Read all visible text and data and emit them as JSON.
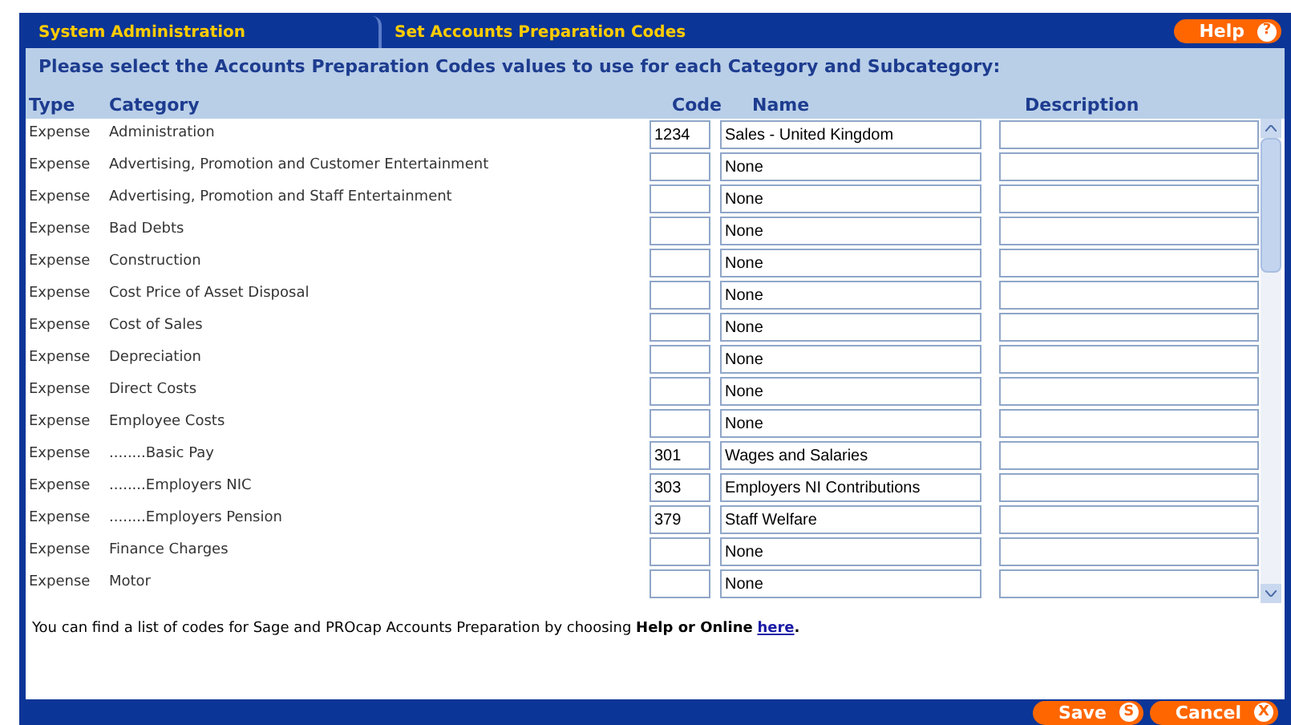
{
  "tabs": [
    {
      "label": "System Administration"
    },
    {
      "label": "Set Accounts Preparation Codes"
    }
  ],
  "help_button": {
    "label": "Help",
    "icon_text": "?"
  },
  "heading": "Please select the Accounts Preparation Codes values to use for each Category and Subcategory:",
  "columns": [
    "Type",
    "Category",
    "Code",
    "Name",
    "Description"
  ],
  "rows": [
    {
      "type": "Expense",
      "category": "Administration",
      "code": "1234",
      "name": "Sales - United Kingdom"
    },
    {
      "type": "Expense",
      "category": "Advertising, Promotion and Customer Entertainment",
      "code": "",
      "name": "None"
    },
    {
      "type": "Expense",
      "category": "Advertising, Promotion and Staff Entertainment",
      "code": "",
      "name": "None"
    },
    {
      "type": "Expense",
      "category": "Bad Debts",
      "code": "",
      "name": "None"
    },
    {
      "type": "Expense",
      "category": "Construction",
      "code": "",
      "name": "None"
    },
    {
      "type": "Expense",
      "category": "Cost Price of Asset Disposal",
      "code": "",
      "name": "None"
    },
    {
      "type": "Expense",
      "category": "Cost of Sales",
      "code": "",
      "name": "None"
    },
    {
      "type": "Expense",
      "category": "Depreciation",
      "code": "",
      "name": "None"
    },
    {
      "type": "Expense",
      "category": "Direct Costs",
      "code": "",
      "name": "None"
    },
    {
      "type": "Expense",
      "category": "Employee Costs",
      "code": "",
      "name": "None"
    },
    {
      "type": "Expense",
      "category": "........Basic Pay",
      "code": "301",
      "name": "Wages and Salaries"
    },
    {
      "type": "Expense",
      "category": "........Employers NIC",
      "code": "303",
      "name": "Employers NI Contributions"
    },
    {
      "type": "Expense",
      "category": "........Employers Pension",
      "code": "379",
      "name": "Staff Welfare"
    },
    {
      "type": "Expense",
      "category": "Finance Charges",
      "code": "",
      "name": "None"
    },
    {
      "type": "Expense",
      "category": "Motor",
      "code": "",
      "name": "None"
    }
  ],
  "footer_note": {
    "text": "You can find a list of codes for Sage and PROcap Accounts Preparation by choosing **Help or Online**",
    "link": "here",
    "after": "."
  },
  "buttons": [
    {
      "label": "Save",
      "icon_text": "S"
    },
    {
      "label": "Cancel",
      "icon_text": "X"
    }
  ]
}
